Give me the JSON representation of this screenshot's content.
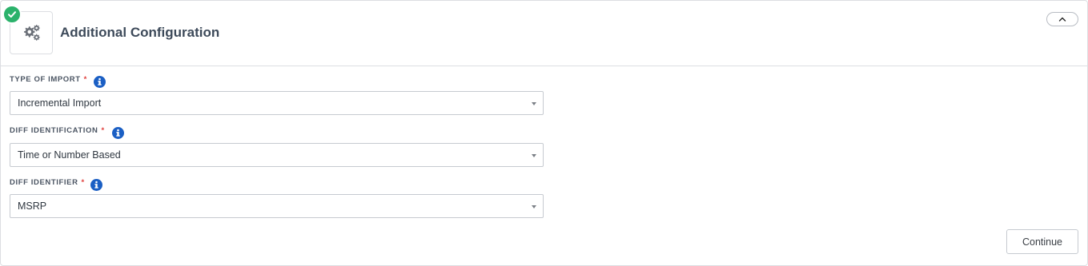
{
  "section": {
    "title": "Additional Configuration",
    "status_icon": "check-circle-icon",
    "section_icon": "gears-icon",
    "collapse_icon": "chevron-up-icon"
  },
  "fields": [
    {
      "label": "TYPE OF IMPORT",
      "required_mark": "*",
      "value": "Incremental Import"
    },
    {
      "label": "DIFF IDENTIFICATION",
      "required_mark": "*",
      "value": "Time or Number Based"
    },
    {
      "label": "DIFF IDENTIFIER",
      "required_mark": "*",
      "value": "MSRP"
    }
  ],
  "actions": {
    "continue_label": "Continue"
  },
  "colors": {
    "success": "#2bb26b",
    "info": "#1b5fc4",
    "required": "#e0413e",
    "title": "#3d4a5a"
  }
}
